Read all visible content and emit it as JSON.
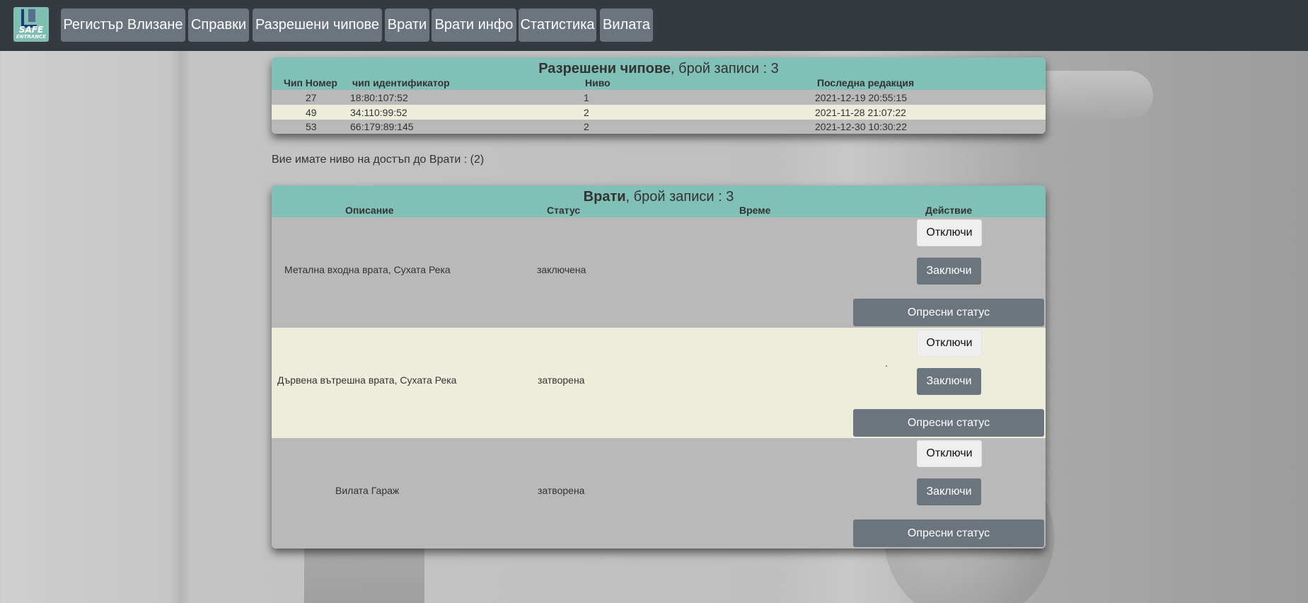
{
  "nav": {
    "logo_line1": "SAFE",
    "logo_line2": "ENTRANCE",
    "items": [
      {
        "label": "Регистър Влизане"
      },
      {
        "label": "Справки"
      },
      {
        "label": "Разрешени чипове"
      },
      {
        "label": "Врати"
      },
      {
        "label": "Врати инфо"
      },
      {
        "label": "Статистика"
      },
      {
        "label": "Вилата"
      }
    ]
  },
  "chips": {
    "title_bold": "Разрешени чипове",
    "title_rest": ", брой записи : 3",
    "columns": [
      "Чип Номер",
      "чип идентификатор",
      "Ниво",
      "Последна редакция"
    ],
    "rows": [
      {
        "number": "27",
        "identifier": "18:80:107:52",
        "level": "1",
        "edited": "2021-12-19 20:55:15"
      },
      {
        "number": "49",
        "identifier": "34:110:99:52",
        "level": "2",
        "edited": "2021-11-28 21:07:22"
      },
      {
        "number": "53",
        "identifier": "66:179:89:145",
        "level": "2",
        "edited": "2021-12-30 10:30:22"
      }
    ]
  },
  "access_note": "Вие имате ниво на достъп до Врати : (2)",
  "doors": {
    "title_bold": "Врати",
    "title_rest": ", брой записи : 3",
    "columns": [
      "Описание",
      "Статус",
      "Време",
      "Действие"
    ],
    "unlock_label": "Отключи",
    "lock_label": "Заключи",
    "refresh_label": "Опресни статус",
    "rows": [
      {
        "description": "Метална входна врата, Сухата Река",
        "status": "заключена",
        "time": ""
      },
      {
        "description": "Дървена вътрешна врата, Сухата Река",
        "status": "затворена",
        "time": "."
      },
      {
        "description": "Вилата Гараж",
        "status": "затворена",
        "time": ""
      }
    ]
  },
  "colors": {
    "navbar": "#343a40",
    "nav_button": "#6c757d",
    "panel_header": "#80c0b6",
    "row_alt": "#ecedda"
  }
}
